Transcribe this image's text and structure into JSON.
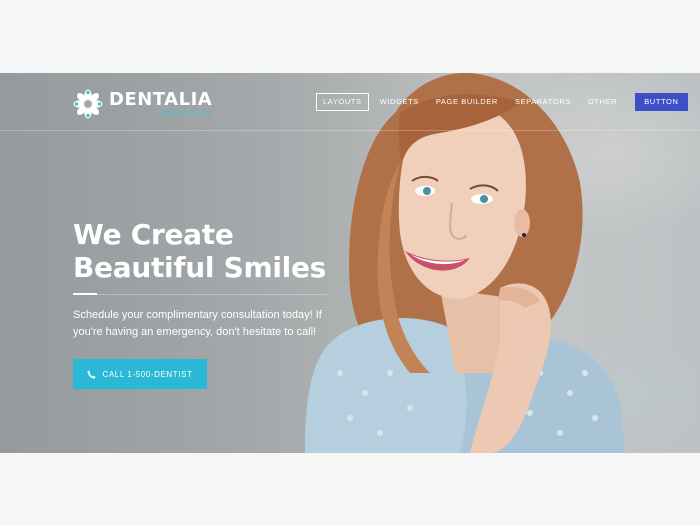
{
  "brand": {
    "name": "DENTALIA",
    "tagline": "dental clinic",
    "accent": "#31c6e0"
  },
  "nav": {
    "items": [
      {
        "label": "LAYOUTS",
        "active": true
      },
      {
        "label": "WIDGETS",
        "active": false
      },
      {
        "label": "PAGE BUILDER",
        "active": false
      },
      {
        "label": "SEPARATORS",
        "active": false
      },
      {
        "label": "OTHER",
        "active": false
      }
    ],
    "button_label": "BUTTON",
    "button_color": "#3c4fc6"
  },
  "hero": {
    "headline_line1": "We Create",
    "headline_line2": "Beautiful Smiles",
    "subtext": "Schedule your complimentary consultation today! If you're having an emergency, don't hesitate to call!",
    "cta_label": "CALL 1-500-DENTIST",
    "cta_icon": "phone-icon",
    "cta_color": "#29b8d6"
  }
}
